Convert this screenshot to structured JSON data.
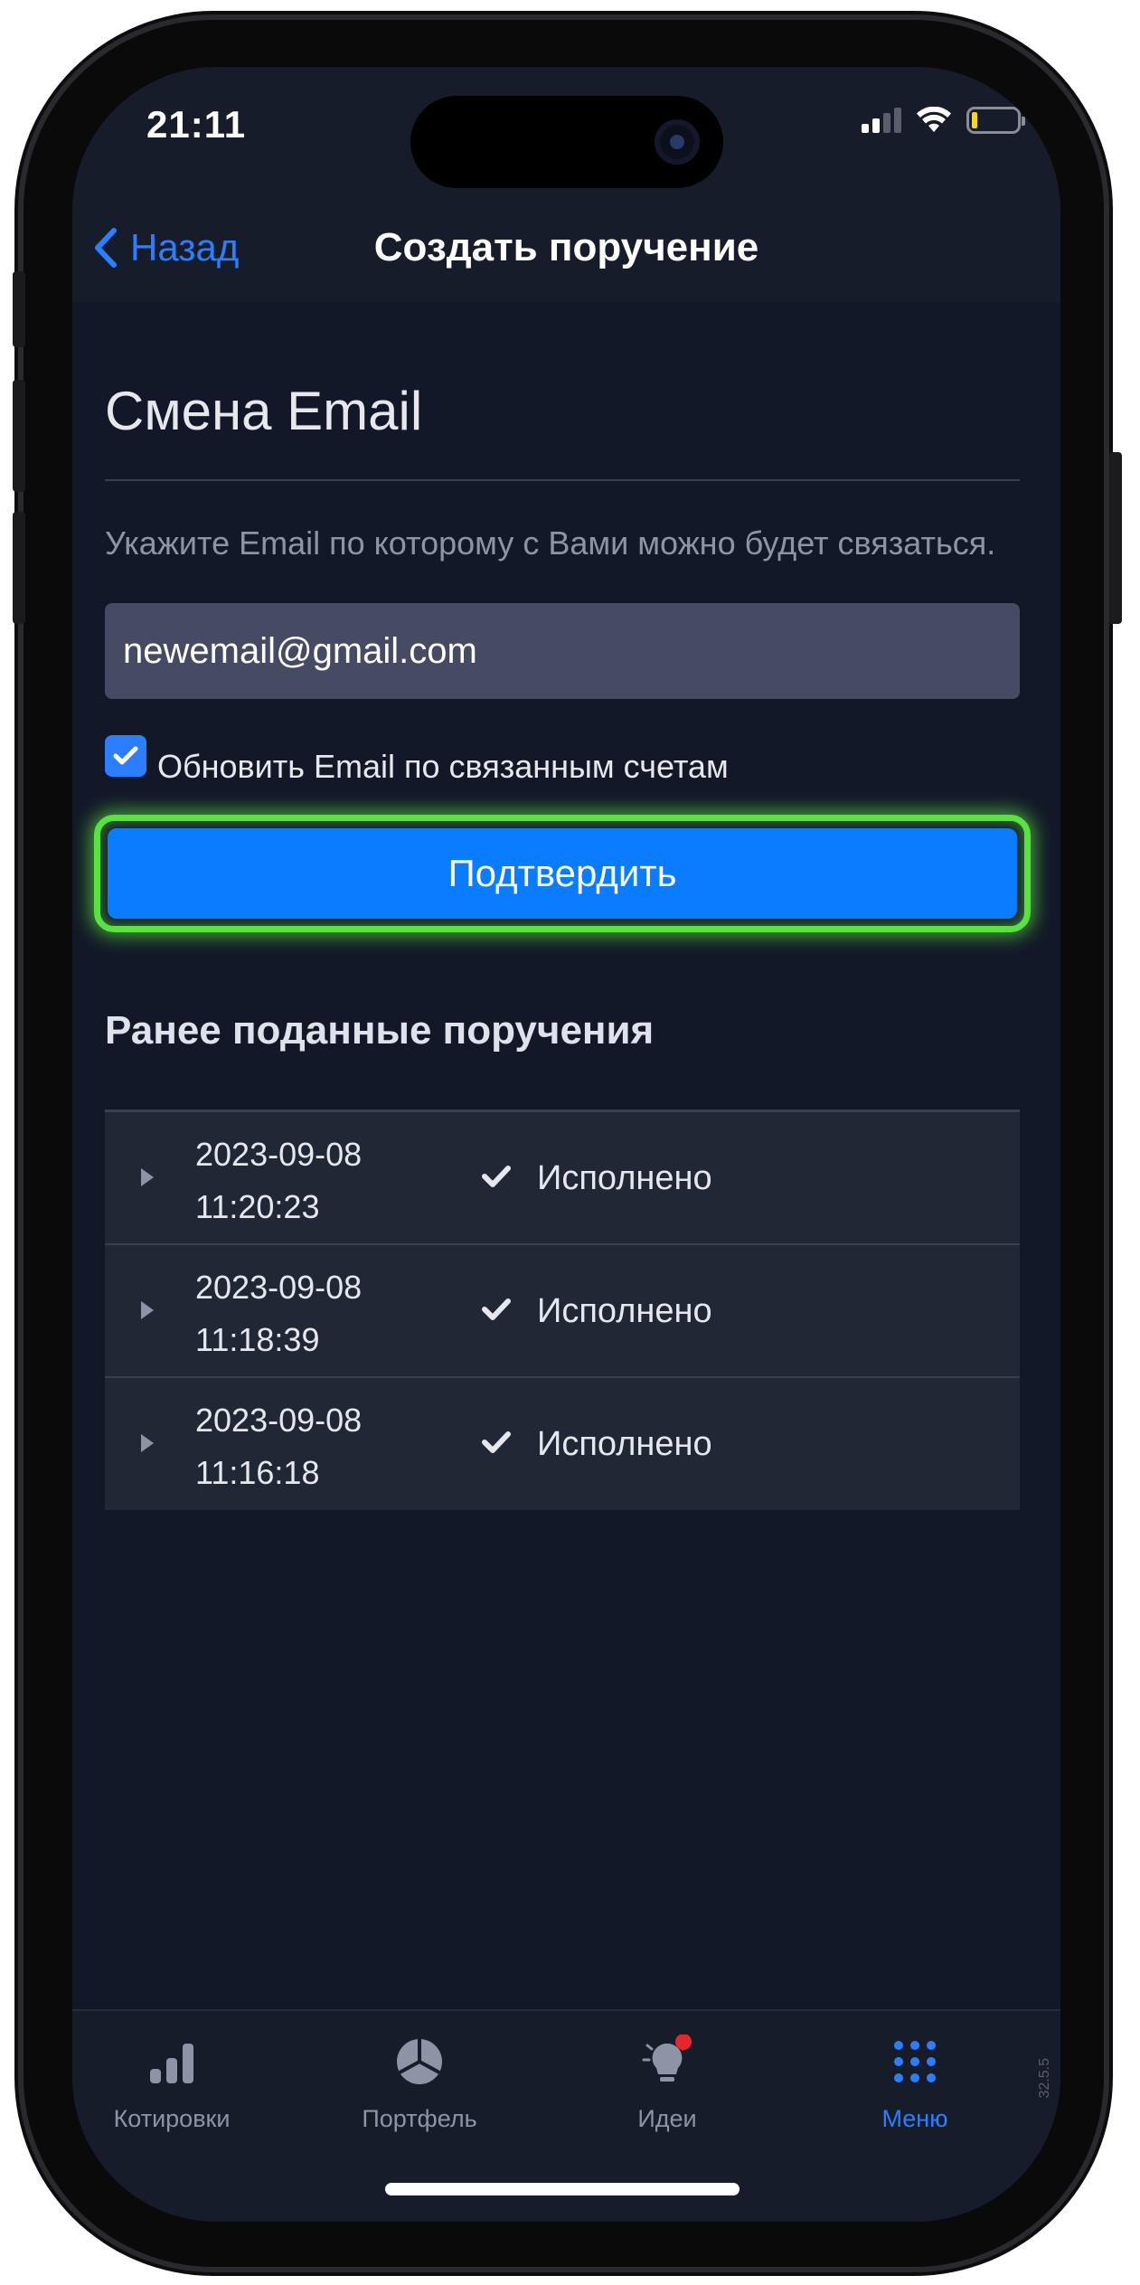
{
  "status_bar": {
    "time": "21:11"
  },
  "nav": {
    "back_label": "Назад",
    "title": "Создать поручение"
  },
  "form": {
    "title": "Смена Email",
    "hint": "Укажите Email по которому с Вами можно будет связаться.",
    "email_value": "newemail@gmail.com",
    "checkbox_checked": true,
    "checkbox_label": "Обновить Email по связанным счетам",
    "confirm_label": "Подтвердить"
  },
  "history": {
    "title": "Ранее поданные поручения",
    "rows": [
      {
        "date": "2023-09-08",
        "time": "11:20:23",
        "status": "Исполнено"
      },
      {
        "date": "2023-09-08",
        "time": "11:18:39",
        "status": "Исполнено"
      },
      {
        "date": "2023-09-08",
        "time": "11:16:18",
        "status": "Исполнено"
      }
    ]
  },
  "tab_bar": {
    "tabs": [
      {
        "label": "Котировки",
        "icon": "bar-chart-icon",
        "active": false
      },
      {
        "label": "Портфель",
        "icon": "pie-chart-icon",
        "active": false
      },
      {
        "label": "Идеи",
        "icon": "lightbulb-icon",
        "active": false,
        "badge": true
      },
      {
        "label": "Меню",
        "icon": "grid-menu-icon",
        "active": true
      }
    ],
    "version": "32.5.5"
  },
  "colors": {
    "accent": "#2b7fff",
    "button": "#0a7cff",
    "highlight": "#59e33f",
    "background": "#131828",
    "badge": "#e5262c"
  }
}
